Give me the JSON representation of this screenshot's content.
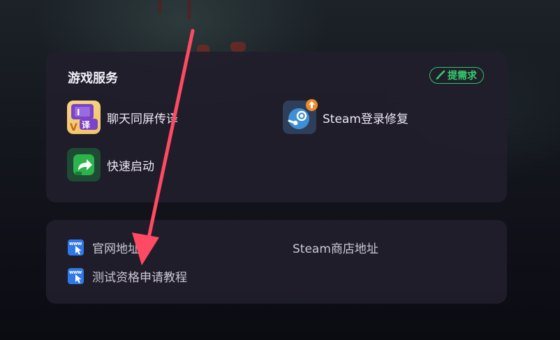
{
  "services": {
    "title": "游戏服务",
    "request_button": "提需求",
    "items": [
      {
        "label": "聊天同屏传译",
        "icon": "chat-translate-icon"
      },
      {
        "label": "Steam登录修复",
        "icon": "steam-repair-icon"
      },
      {
        "label": "快速启动",
        "icon": "quick-launch-icon"
      }
    ]
  },
  "links": {
    "items": [
      {
        "label": "官网地址",
        "icon": "www-icon"
      },
      {
        "label": "Steam商店地址"
      },
      {
        "label": "测试资格申请教程",
        "icon": "www-icon"
      }
    ]
  },
  "colors": {
    "accent_green": "#34cf6c",
    "card_bg": "#211e2c",
    "arrow": "#ff4a63"
  }
}
